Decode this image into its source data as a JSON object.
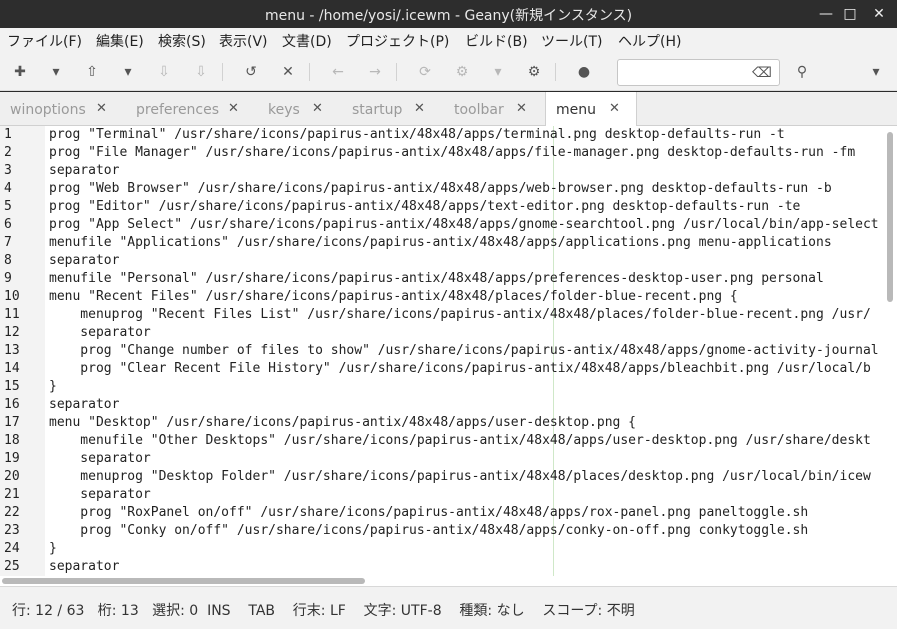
{
  "window": {
    "title": "menu - /home/yosi/.icewm - Geany(新規インスタンス)",
    "minimize_icon": "minimize-icon",
    "maximize_icon": "maximize-icon",
    "close_icon": "close-icon"
  },
  "menubar": {
    "items": [
      "ファイル(F)",
      "編集(E)",
      "検索(S)",
      "表示(V)",
      "文書(D)",
      "プロジェクト(P)",
      "ビルド(B)",
      "ツール(T)",
      "ヘルプ(H)"
    ]
  },
  "toolbar": {
    "icons": [
      "new-file-icon",
      "dropdown-icon",
      "open-file-icon",
      "dropdown-icon",
      "save-icon",
      "save-all-icon",
      "revert-icon",
      "close-file-icon",
      "back-icon",
      "forward-icon",
      "reload-icon",
      "compile-icon",
      "dropdown-icon",
      "build-icon",
      "color-picker-icon",
      "clear-search-icon",
      "search-icon",
      "overflow-menu-icon"
    ],
    "search_value": ""
  },
  "tabs": [
    {
      "label": "winoptions",
      "active": false
    },
    {
      "label": "preferences",
      "active": false
    },
    {
      "label": "keys",
      "active": false
    },
    {
      "label": "startup",
      "active": false
    },
    {
      "label": "toolbar",
      "active": false
    },
    {
      "label": "menu",
      "active": true
    }
  ],
  "editor": {
    "lines": [
      {
        "n": "1",
        "text": "prog \"Terminal\" /usr/share/icons/papirus-antix/48x48/apps/terminal.png desktop-defaults-run -t"
      },
      {
        "n": "2",
        "text": "prog \"File Manager\" /usr/share/icons/papirus-antix/48x48/apps/file-manager.png desktop-defaults-run -fm"
      },
      {
        "n": "3",
        "text": "separator"
      },
      {
        "n": "4",
        "text": "prog \"Web Browser\" /usr/share/icons/papirus-antix/48x48/apps/web-browser.png desktop-defaults-run -b"
      },
      {
        "n": "5",
        "text": "prog \"Editor\" /usr/share/icons/papirus-antix/48x48/apps/text-editor.png desktop-defaults-run -te"
      },
      {
        "n": "6",
        "text": "prog \"App Select\" /usr/share/icons/papirus-antix/48x48/apps/gnome-searchtool.png /usr/local/bin/app-select"
      },
      {
        "n": "7",
        "text": "menufile \"Applications\" /usr/share/icons/papirus-antix/48x48/apps/applications.png menu-applications"
      },
      {
        "n": "8",
        "text": "separator"
      },
      {
        "n": "9",
        "text": "menufile \"Personal\" /usr/share/icons/papirus-antix/48x48/apps/preferences-desktop-user.png personal"
      },
      {
        "n": "10",
        "text": "menu \"Recent Files\" /usr/share/icons/papirus-antix/48x48/places/folder-blue-recent.png {"
      },
      {
        "n": "11",
        "text": "    menuprog \"Recent Files List\" /usr/share/icons/papirus-antix/48x48/places/folder-blue-recent.png /usr/"
      },
      {
        "n": "12",
        "text": "    separator"
      },
      {
        "n": "13",
        "text": "    prog \"Change number of files to show\" /usr/share/icons/papirus-antix/48x48/apps/gnome-activity-journal"
      },
      {
        "n": "14",
        "text": "    prog \"Clear Recent File History\" /usr/share/icons/papirus-antix/48x48/apps/bleachbit.png /usr/local/b"
      },
      {
        "n": "15",
        "text": "}"
      },
      {
        "n": "16",
        "text": "separator"
      },
      {
        "n": "17",
        "text": "menu \"Desktop\" /usr/share/icons/papirus-antix/48x48/apps/user-desktop.png {"
      },
      {
        "n": "18",
        "text": "    menufile \"Other Desktops\" /usr/share/icons/papirus-antix/48x48/apps/user-desktop.png /usr/share/deskt"
      },
      {
        "n": "19",
        "text": "    separator"
      },
      {
        "n": "20",
        "text": "    menuprog \"Desktop Folder\" /usr/share/icons/papirus-antix/48x48/places/desktop.png /usr/local/bin/icew"
      },
      {
        "n": "21",
        "text": "    separator"
      },
      {
        "n": "22",
        "text": "    prog \"RoxPanel on/off\" /usr/share/icons/papirus-antix/48x48/apps/rox-panel.png paneltoggle.sh"
      },
      {
        "n": "23",
        "text": "    prog \"Conky on/off\" /usr/share/icons/papirus-antix/48x48/apps/conky-on-off.png conkytoggle.sh"
      },
      {
        "n": "24",
        "text": "}"
      },
      {
        "n": "25",
        "text": "separator"
      }
    ]
  },
  "statusbar": {
    "text": "行: 12 / 63   桁: 13   選択: 0  INS    TAB    行末: LF    文字: UTF-8    種類: なし    スコープ: 不明"
  }
}
